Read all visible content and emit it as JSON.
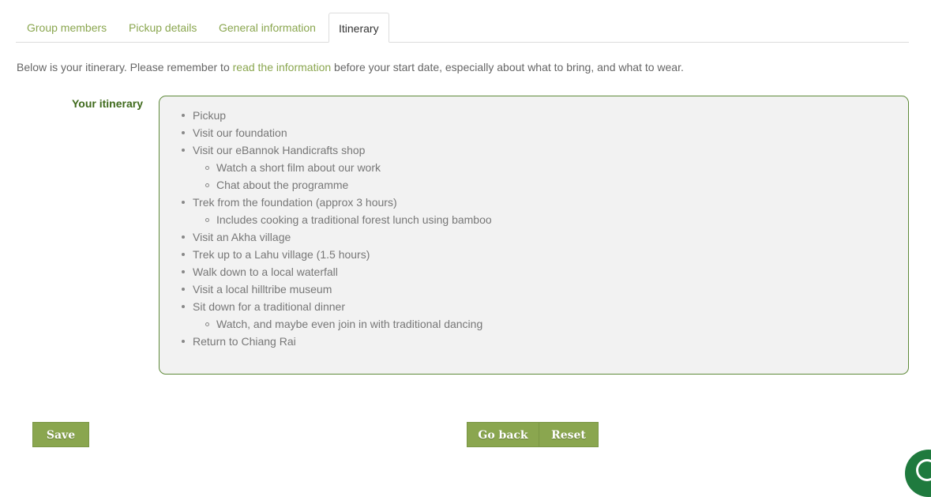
{
  "tabs": [
    {
      "label": "Group members"
    },
    {
      "label": "Pickup details"
    },
    {
      "label": "General information"
    },
    {
      "label": "Itinerary",
      "active": true
    }
  ],
  "intro": {
    "before": "Below is your itinerary. Please remember to ",
    "link": "read the information",
    "after": " before your start date, especially about what to bring, and what to wear."
  },
  "itinerary": {
    "label": "Your itinerary",
    "items": [
      {
        "text": "Pickup"
      },
      {
        "text": "Visit our foundation"
      },
      {
        "text": "Visit our eBannok Handicrafts shop",
        "sub": [
          "Watch a short film about our work",
          "Chat about the programme"
        ]
      },
      {
        "text": "Trek from the foundation (approx 3 hours)",
        "sub": [
          "Includes cooking a traditional forest lunch using bamboo"
        ]
      },
      {
        "text": "Visit an Akha village"
      },
      {
        "text": "Trek up to a Lahu village (1.5 hours)"
      },
      {
        "text": "Walk down to a local waterfall"
      },
      {
        "text": "Visit a local hilltribe museum"
      },
      {
        "text": "Sit down for a traditional dinner",
        "sub": [
          "Watch, and maybe even join in with traditional dancing"
        ]
      },
      {
        "text": "Return to Chiang Rai"
      }
    ]
  },
  "buttons": {
    "save": "Save",
    "go_back": "Go back",
    "reset": "Reset"
  },
  "colors": {
    "accent": "#8aa64f",
    "label": "#3f6a1c",
    "box_border": "#5f8a3a",
    "box_bg": "#f2f2f2",
    "fab": "#1f7a3e"
  },
  "icons": {
    "chat_fab": "chat-icon"
  }
}
